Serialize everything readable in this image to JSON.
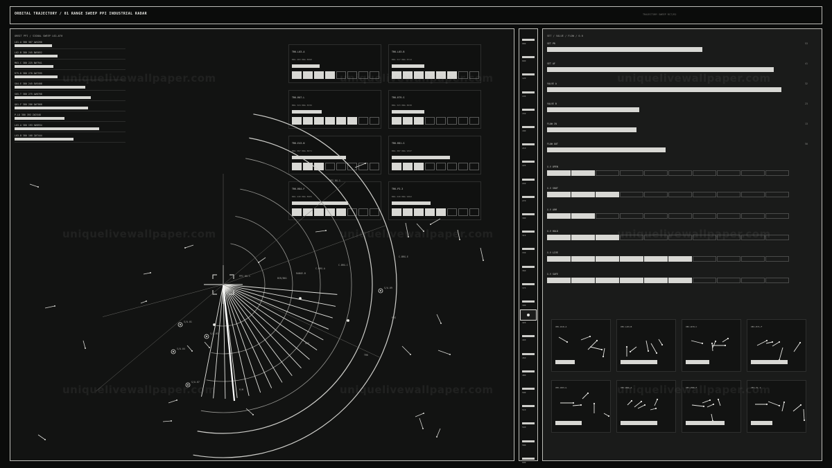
{
  "header": {
    "title": "ORBITAL TRAJECTORY  /  01  RANGE SWEEP PPI   INDUSTRIAL RADAR",
    "status": "TRAJECTORY SWEEP RC7/R2"
  },
  "left": {
    "subtitle": "ORBIT PPI  /  SIGNAL SWEEP  L02–070",
    "list": [
      {
        "label": "L01-A  380 367  A#4260",
        "level": 0.34
      },
      {
        "label": "L02-B  380 245  B#5052",
        "level": 0.39
      },
      {
        "label": "M03-C  380 225  B#7941",
        "level": 0.35
      },
      {
        "label": "R75-D  380 270  D#7595",
        "level": 0.39
      },
      {
        "label": "S04-E  380 245  E#5408",
        "level": 0.64
      },
      {
        "label": "S05-T  380 275  A#6768",
        "level": 0.69
      },
      {
        "label": "Q01-F  380 286  D#7068",
        "level": 0.66
      },
      {
        "label": "P-LU  380 393  Z#2548",
        "level": 0.45
      },
      {
        "label": "L03-A  380 193  H#8934",
        "level": 0.76
      },
      {
        "label": "L03-B  380 168  Z#7444",
        "level": 0.53
      }
    ],
    "cards": [
      {
        "title": "TRK-L03-A",
        "sub": "BRG 283  RNG 8990",
        "level": 0.32,
        "on": 4
      },
      {
        "title": "TRK-L03-B",
        "sub": "BRG 317  RNG 8714",
        "level": 0.38,
        "on": 6
      },
      {
        "title": "TRK-R07-L",
        "sub": "BRG 324  RNG 8336",
        "level": 0.35,
        "on": 6
      },
      {
        "title": "TRK-R79-S",
        "sub": "BRG 323  RNG 8638",
        "level": 0.38,
        "on": 3
      },
      {
        "title": "TRK-E43-N",
        "sub": "BRG 367  RNG 8671",
        "level": 0.63,
        "on": 3
      },
      {
        "title": "TRK-R81-G",
        "sub": "BRG 387  RNG 9347",
        "level": 0.68,
        "on": 3
      },
      {
        "title": "TRK-R84-F",
        "sub": "BRG 240  RNG 8965",
        "level": 0.65,
        "on": 5
      },
      {
        "title": "TRK-P3-3",
        "sub": "BRG 249  RNG 9462",
        "level": 0.45,
        "on": 5
      }
    ],
    "radar_labels": [
      "PPI RG-1",
      "BIR/B01",
      "RANGE-B",
      "C-BRG-A",
      "C-BRG-C",
      "C-BRG-E",
      "POS",
      "TRK",
      "GEO",
      "P/M"
    ],
    "targets": [
      "S/A-01",
      "S/A-02",
      "S/A-04",
      "S/A-07",
      "S/A-09",
      "S/A-11"
    ]
  },
  "strip": {
    "labels": [
      "080",
      "090",
      "120",
      "135",
      "150",
      "180",
      "210",
      "225",
      "240",
      "270",
      "300",
      "315",
      "330",
      "360",
      "375",
      "390",
      "420",
      "440",
      "450",
      "480",
      "500",
      "510",
      "540",
      "580",
      "600"
    ],
    "cursor_value": "450"
  },
  "right": {
    "subtitle": "SET / VALUE / FLOW / 0.0",
    "bars": [
      {
        "label": "SET PR",
        "value": "53",
        "level": 0.59
      },
      {
        "label": "SET AF",
        "value": "41",
        "level": 0.86
      },
      {
        "label": "VALVE A",
        "value": "32",
        "level": 0.89
      },
      {
        "label": "VALVE B",
        "value": "23",
        "level": 0.35
      },
      {
        "label": "FLOW IN",
        "value": "13",
        "level": 0.34
      },
      {
        "label": "FLOW OUT",
        "value": "50",
        "level": 0.45
      }
    ],
    "segments": [
      {
        "label": "X-V OPEN",
        "on": 2
      },
      {
        "label": "X-V SHUT",
        "on": 3
      },
      {
        "label": "X-V ARM",
        "on": 2
      },
      {
        "label": "X-V HOLD",
        "on": 3
      },
      {
        "label": "X-V LIVE",
        "on": 6
      },
      {
        "label": "X-V SAFE",
        "on": 6
      }
    ],
    "vectors": [
      {
        "title": "VEC-D10-A",
        "level": 0.38
      },
      {
        "title": "VEC-L03-B",
        "level": 0.72
      },
      {
        "title": "VEC-R79-C",
        "level": 0.46
      },
      {
        "title": "VEC-E71-F",
        "level": 0.72
      },
      {
        "title": "VEC-D03-G",
        "level": 0.51
      },
      {
        "title": "VEC-R81-A",
        "level": 0.72
      },
      {
        "title": "VEC-P86-F",
        "level": 0.75
      },
      {
        "title": "VEC-TL-1",
        "level": 0.42
      }
    ]
  },
  "watermark": "uniquelivewallpaper.com",
  "colors": {
    "background": "#0b0c0b",
    "panel": "#121312",
    "accent": "#d8d8d4"
  }
}
